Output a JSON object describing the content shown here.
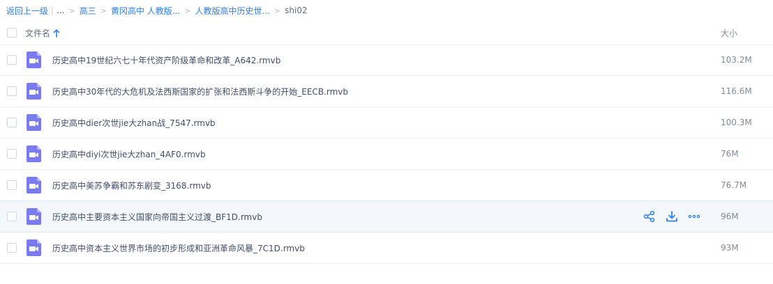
{
  "breadcrumb": {
    "back_label": "返回上一级",
    "separator_bar": "|",
    "ellipsis": "...",
    "separator": ">",
    "items": [
      "高三",
      "黄冈高中 人教版...",
      "人教版高中历史世..."
    ],
    "current": "shi02"
  },
  "header": {
    "name_label": "文件名",
    "size_label": "大小",
    "sort_icon": "arrow-up-icon"
  },
  "files": [
    {
      "name": "历史高中19世纪六七十年代资产阶级革命和改革_A642.rmvb",
      "size": "103.2M",
      "icon": "video-file-icon"
    },
    {
      "name": "历史高中30年代的大危机及法西斯国家的扩张和法西斯斗争的开始_EECB.rmvb",
      "size": "116.6M",
      "icon": "video-file-icon"
    },
    {
      "name": "历史高中dier次世jie大zhan战_7547.rmvb",
      "size": "100.3M",
      "icon": "video-file-icon"
    },
    {
      "name": "历史高中diyi次世jie大zhan_4AF0.rmvb",
      "size": "76M",
      "icon": "video-file-icon"
    },
    {
      "name": "历史高中美苏争霸和苏东剧变_3168.rmvb",
      "size": "76.7M",
      "icon": "video-file-icon"
    },
    {
      "name": "历史高中主要资本主义国家向帝国主义过渡_BF1D.rmvb",
      "size": "96M",
      "icon": "video-file-icon",
      "hover": true
    },
    {
      "name": "历史高中资本主义世界市场的初步形成和亚洲革命风暴_7C1D.rmvb",
      "size": "93M",
      "icon": "video-file-icon"
    }
  ],
  "row_actions": [
    "share-icon",
    "download-icon",
    "more-icon"
  ],
  "colors": {
    "link": "#2f80ed",
    "icon_purple": "#7b7bf0",
    "hover_row": "#f4f8fc",
    "action_blue": "#2f80ed"
  }
}
